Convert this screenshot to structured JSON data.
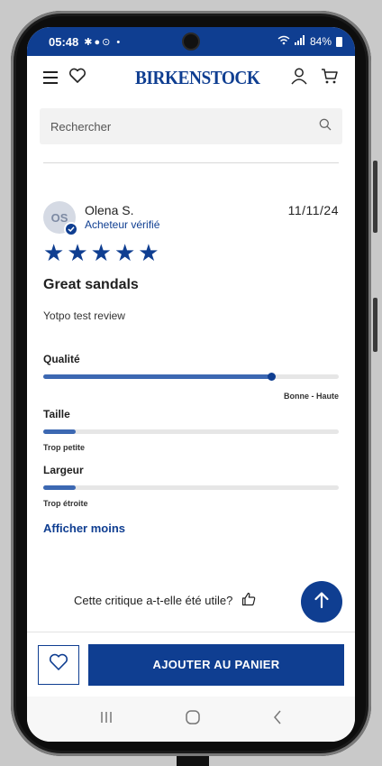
{
  "status_bar": {
    "time": "05:48",
    "battery": "84%"
  },
  "header": {
    "brand": "BIRKENSTOCK"
  },
  "search": {
    "placeholder": "Rechercher"
  },
  "review": {
    "initials": "OS",
    "name": "Olena S.",
    "verified_label": "Acheteur vérifié",
    "date": "11/11/24",
    "rating": 5,
    "title": "Great sandals",
    "body": "Yotpo test review",
    "attributes": [
      {
        "label": "Qualité",
        "value_label": "Bonne - Haute",
        "level": 0.77
      },
      {
        "label": "Taille",
        "value_label": "Trop petite",
        "level": 0.11
      },
      {
        "label": "Largeur",
        "value_label": "Trop étroite",
        "level": 0.11
      }
    ],
    "show_less": "Afficher moins",
    "helpful_question": "Cette critique a-t-elle été utile?"
  },
  "bottom_bar": {
    "add_to_cart": "AJOUTER AU PANIER"
  },
  "colors": {
    "brand_blue": "#0f3e91",
    "bar_fill": "#3c68b2",
    "bar_track": "#e6e6e6"
  }
}
